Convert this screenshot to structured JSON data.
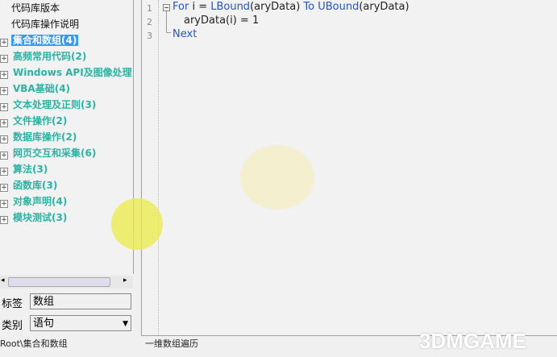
{
  "tree": {
    "leaves": [
      "代码库版本",
      "代码库操作说明"
    ],
    "nodes": [
      "集合和数组(4)",
      "高频常用代码(2)",
      "Windows API及图像处理",
      "VBA基础(4)",
      "文本处理及正则(3)",
      "文件操作(2)",
      "数据库操作(2)",
      "网页交互和采集(6)",
      "算法(3)",
      "函数库(3)",
      "对象声明(4)",
      "模块测试(3)"
    ],
    "selected_index": 0
  },
  "fields": {
    "tag_label": "标签",
    "tag_value": "数组",
    "category_label": "类别",
    "category_value": "语句"
  },
  "status": {
    "path": "Root\\集合和数组",
    "description": "一维数组遍历"
  },
  "editor": {
    "line_numbers": [
      "1",
      "2",
      "3"
    ],
    "line1": {
      "kw1": "For",
      "t1": " i = ",
      "kw2": "LBound",
      "t2": "(aryData) ",
      "kw3": "To",
      "t3": " ",
      "kw4": "UBound",
      "t4": "(aryData)"
    },
    "line2": "aryData(i) = 1",
    "line3": "Next"
  },
  "watermark": "3DMGAME"
}
